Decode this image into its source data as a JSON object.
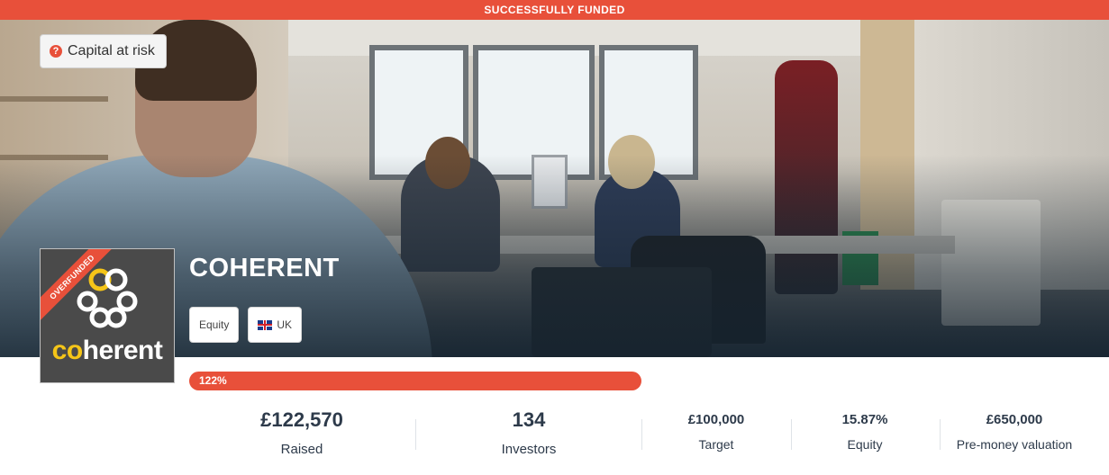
{
  "banner": {
    "text": "SUCCESSFULLY FUNDED"
  },
  "risk": {
    "label": "Capital at risk",
    "icon": "question-icon"
  },
  "company": {
    "name": "COHERENT",
    "logo_text": "coherent",
    "ribbon": "OVERFUNDED"
  },
  "tags": [
    {
      "label": "Equity"
    },
    {
      "label": "UK",
      "icon": "uk-flag-icon"
    }
  ],
  "progress": {
    "label": "122%",
    "percent": 122
  },
  "stats": {
    "raised": {
      "value": "£122,570",
      "label": "Raised"
    },
    "investors": {
      "value": "134",
      "label": "Investors"
    },
    "target": {
      "value": "£100,000",
      "label": "Target"
    },
    "equity": {
      "value": "15.87%",
      "label": "Equity"
    },
    "valuation": {
      "value": "£650,000",
      "label": "Pre-money valuation"
    }
  },
  "colors": {
    "accent": "#e8503a",
    "logo_yellow": "#f5c518",
    "text": "#2d3a4a"
  }
}
